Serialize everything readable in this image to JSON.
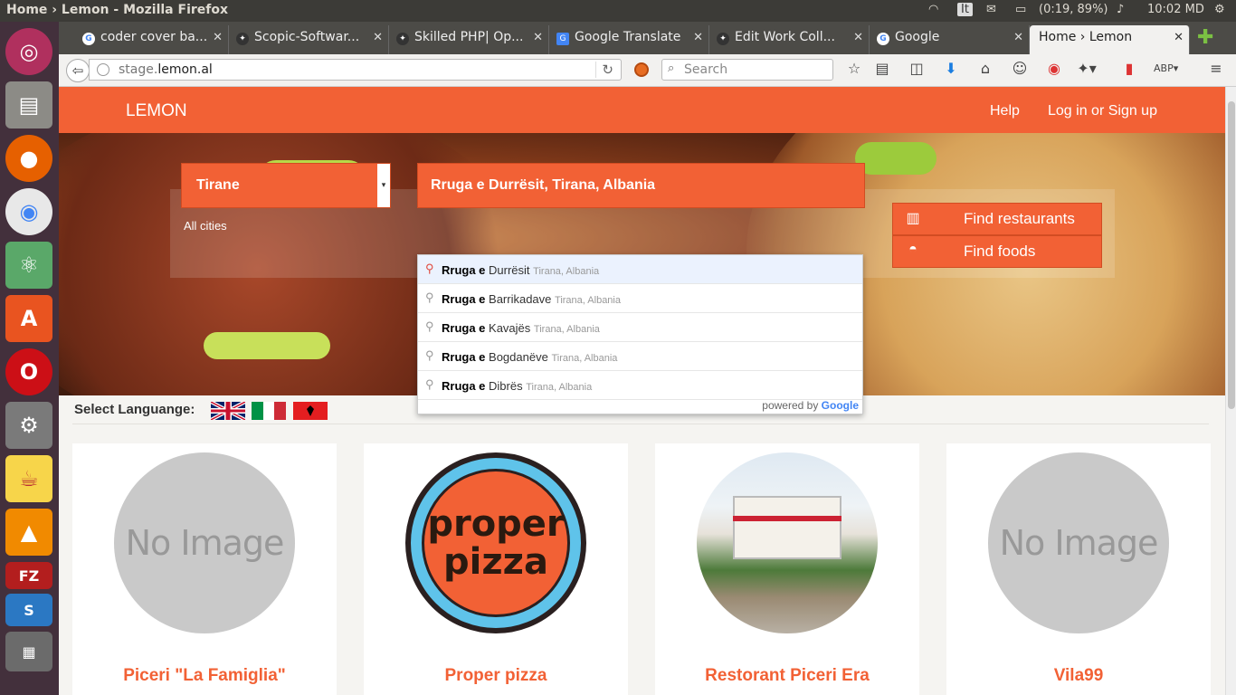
{
  "os": {
    "window_title": "Home › Lemon - Mozilla Firefox",
    "keyboard_layout": "It",
    "battery": "(0:19, 89%)",
    "clock": "10:02 MD"
  },
  "launcher": {
    "items": [
      "ubuntu-dash",
      "files",
      "firefox",
      "chrome",
      "atom",
      "software-center",
      "opera",
      "system-settings",
      "teapot",
      "vlc",
      "filezilla",
      "sublime",
      "scanner"
    ]
  },
  "browser": {
    "tabs": [
      {
        "label": "coder cover ba...",
        "icon": "google-icon"
      },
      {
        "label": "Scopic-Softwar...",
        "icon": "ninja-icon"
      },
      {
        "label": "Skilled PHP| Op...",
        "icon": "ninja-icon"
      },
      {
        "label": "Google Translate",
        "icon": "translate-icon"
      },
      {
        "label": "Edit Work Coll...",
        "icon": "ninja-icon"
      },
      {
        "label": "Google",
        "icon": "google-icon"
      },
      {
        "label": "Home › Lemon",
        "icon": ""
      }
    ],
    "url_host": "stage.",
    "url_domain": "lemon.al",
    "search_placeholder": "Search"
  },
  "site": {
    "logo": "LEMON",
    "nav": {
      "help": "Help",
      "login": "Log in or Sign up"
    },
    "city_value": "Tirane",
    "all_cities": "All cities",
    "address_value": "Rruga e Durrësit, Tirana, Albania",
    "find_restaurants": "Find restaurants",
    "find_foods": "Find foods",
    "suggestions": [
      {
        "match": "Rruga e",
        "rest": " Durrësit",
        "secondary": "Tirana, Albania"
      },
      {
        "match": "Rruga e",
        "rest": " Barrikadave",
        "secondary": "Tirana, Albania"
      },
      {
        "match": "Rruga e",
        "rest": " Kavajës",
        "secondary": "Tirana, Albania"
      },
      {
        "match": "Rruga e",
        "rest": " Bogdanëve",
        "secondary": "Tirana, Albania"
      },
      {
        "match": "Rruga e",
        "rest": " Dibrës",
        "secondary": "Tirana, Albania"
      }
    ],
    "powered_by": "powered by ",
    "powered_brand": "Google",
    "language_label": "Select Languange:",
    "languages": [
      "english-flag",
      "italian-flag",
      "albanian-flag"
    ],
    "no_image_text": "No Image",
    "proper_logo_line1": "proper",
    "proper_logo_line2": "pizza",
    "restaurants": [
      {
        "name": "Piceri \"La Famiglia\""
      },
      {
        "name": "Proper pizza"
      },
      {
        "name": "Restorant Piceri Era"
      },
      {
        "name": "Vila99"
      }
    ]
  },
  "colors": {
    "brand": "#f26135",
    "highlight": "#ebf2fe"
  }
}
